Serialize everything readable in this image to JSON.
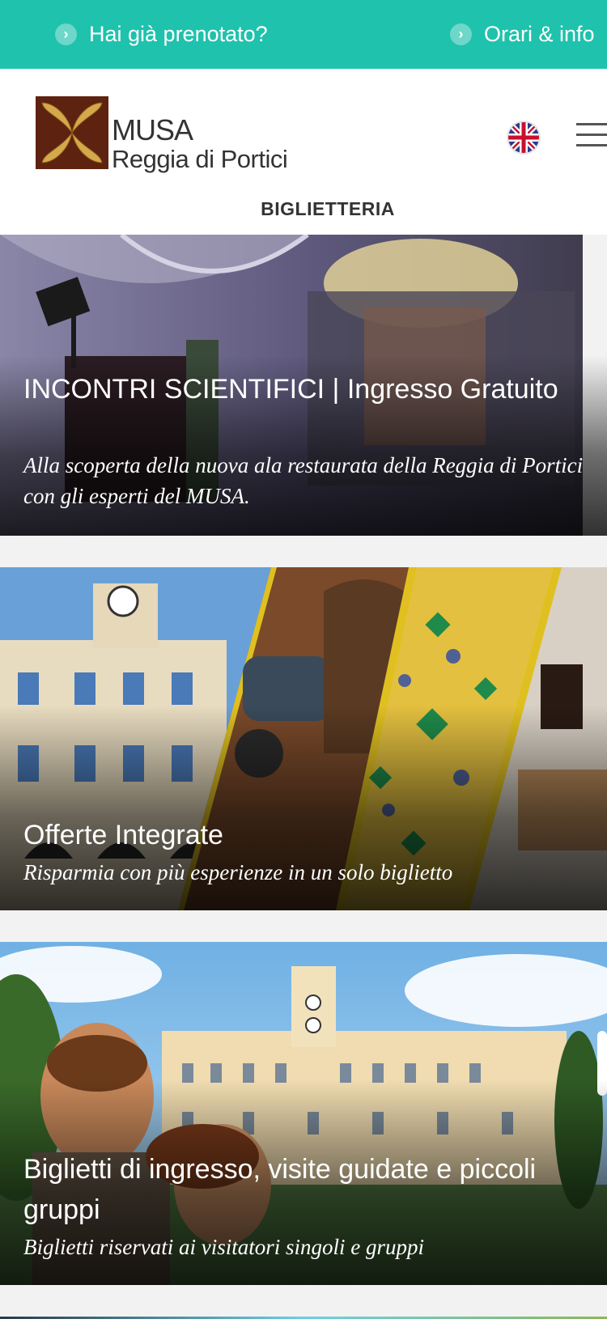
{
  "topbar": {
    "booked_link": "Hai già prenotato?",
    "info_link": "Orari & info",
    "color": "#1fc2ac"
  },
  "header": {
    "logo_line1": "MUSA",
    "logo_line2": "Reggia di Portici",
    "language_icon": "uk-flag-icon",
    "menu_icon": "hamburger-menu-icon",
    "section_title": "BIGLIETTERIA"
  },
  "cards": [
    {
      "title": "INCONTRI SCIENTIFICI | Ingresso Gratuito",
      "subtitle": "Alla scoperta della nuova ala restaurata della Reggia di Portici con gli esperti del MUSA."
    },
    {
      "title": "Offerte Integrate",
      "subtitle": "Risparmia con più esperienze in un solo biglietto"
    },
    {
      "title": "Biglietti di ingresso, visite guidate e piccoli gruppi",
      "subtitle": "Biglietti riservati ai visitatori singoli e gruppi"
    }
  ]
}
